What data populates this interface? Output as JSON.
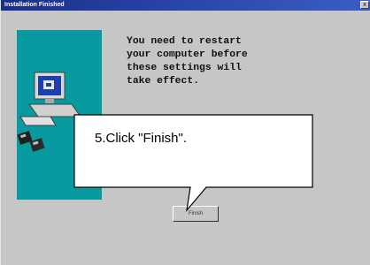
{
  "window": {
    "title": "Installation Finished",
    "close_glyph": "x"
  },
  "art": {
    "icon": "computer-install-icon",
    "panel_color": "#079aa0"
  },
  "message": {
    "text": "You need to restart\nyour computer before\nthese settings will\ntake effect."
  },
  "finish_button": {
    "label": "Finish"
  },
  "callout": {
    "text": "5.Click \"Finish\"."
  },
  "colors": {
    "titlebar": "#1a2e8c",
    "dialog_bg": "#c6c6c6"
  }
}
